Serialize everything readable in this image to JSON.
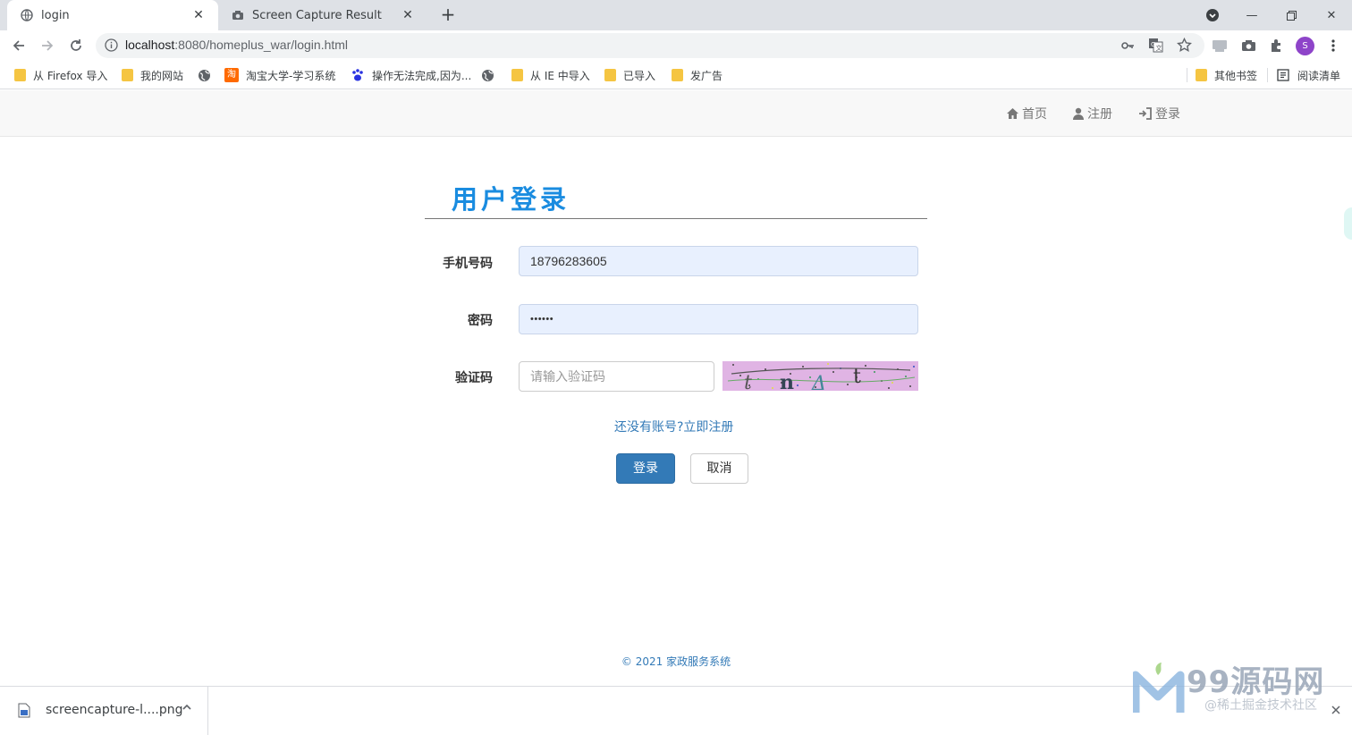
{
  "browser": {
    "tabs": [
      {
        "label": "login",
        "active": true,
        "icon": "globe-icon"
      },
      {
        "label": "Screen Capture Result",
        "active": false,
        "icon": "camera-icon"
      }
    ],
    "url_host": "localhost",
    "url_rest": ":8080/homeplus_war/login.html",
    "avatar_initial": "S",
    "bookmarks": [
      {
        "label": "从 Firefox 导入",
        "icon": "folder-icon"
      },
      {
        "label": "我的网站",
        "icon": "folder-icon"
      },
      {
        "label": "",
        "icon": "globe-icon"
      },
      {
        "label": "淘宝大学-学习系统",
        "icon": "taobao-icon"
      },
      {
        "label": "操作无法完成,因为...",
        "icon": "baidu-paw-icon"
      },
      {
        "label": "",
        "icon": "globe-icon"
      },
      {
        "label": "从 IE 中导入",
        "icon": "folder-icon"
      },
      {
        "label": "已导入",
        "icon": "folder-icon"
      },
      {
        "label": "发广告",
        "icon": "folder-icon"
      }
    ],
    "other_bookmarks": "其他书签",
    "reading_list": "阅读清单"
  },
  "navbar": {
    "home": "首页",
    "register": "注册",
    "login": "登录"
  },
  "login": {
    "title": "用户登录",
    "phone_label": "手机号码",
    "phone_value": "18796283605",
    "password_label": "密码",
    "password_value": "••••••",
    "captcha_label": "验证码",
    "captcha_placeholder": "请输入验证码",
    "register_link": "还没有账号?立即注册",
    "login_button": "登录",
    "cancel_button": "取消"
  },
  "footer": {
    "text": "© 2021 家政服务系统"
  },
  "downloads": {
    "filename": "screencapture-l....png"
  },
  "watermark": {
    "text": "99源码网",
    "sub": "@稀土掘金技术社区"
  },
  "colors": {
    "brand_blue": "#1a8ce0",
    "link_blue": "#337ab7",
    "autofill_bg": "#e8f0fe"
  }
}
